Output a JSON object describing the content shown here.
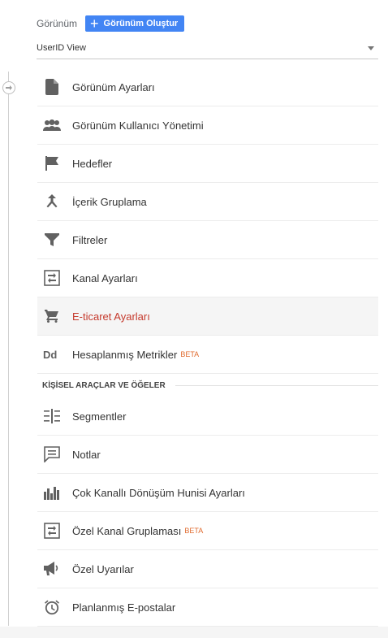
{
  "header": {
    "view_label": "Görünüm",
    "create_button": "Görünüm Oluştur",
    "selected_view": "UserID View"
  },
  "menu_items": [
    {
      "label": "Görünüm Ayarları",
      "icon": "document-icon"
    },
    {
      "label": "Görünüm Kullanıcı Yönetimi",
      "icon": "users-icon"
    },
    {
      "label": "Hedefler",
      "icon": "flag-icon"
    },
    {
      "label": "İçerik Gruplama",
      "icon": "merge-icon"
    },
    {
      "label": "Filtreler",
      "icon": "filter-icon"
    },
    {
      "label": "Kanal Ayarları",
      "icon": "channel-icon"
    },
    {
      "label": "E-ticaret Ayarları",
      "icon": "cart-icon",
      "active": true
    },
    {
      "label": "Hesaplanmış Metrikler",
      "icon": "dd-icon",
      "badge": "BETA"
    }
  ],
  "section": {
    "title": "KİŞİSEL ARAÇLAR VE ÖĞELER"
  },
  "tool_items": [
    {
      "label": "Segmentler",
      "icon": "segments-icon"
    },
    {
      "label": "Notlar",
      "icon": "notes-icon"
    },
    {
      "label": "Çok Kanallı Dönüşüm Hunisi Ayarları",
      "icon": "bar-chart-icon"
    },
    {
      "label": "Özel Kanal Gruplaması",
      "icon": "channel-icon",
      "badge": "BETA"
    },
    {
      "label": "Özel Uyarılar",
      "icon": "megaphone-icon"
    },
    {
      "label": "Planlanmış E-postalar",
      "icon": "alarm-clock-icon"
    }
  ],
  "colors": {
    "accent_blue": "#4285f4",
    "active_red": "#c5392c",
    "beta_orange": "#e06b2f",
    "icon_gray": "#616161"
  }
}
